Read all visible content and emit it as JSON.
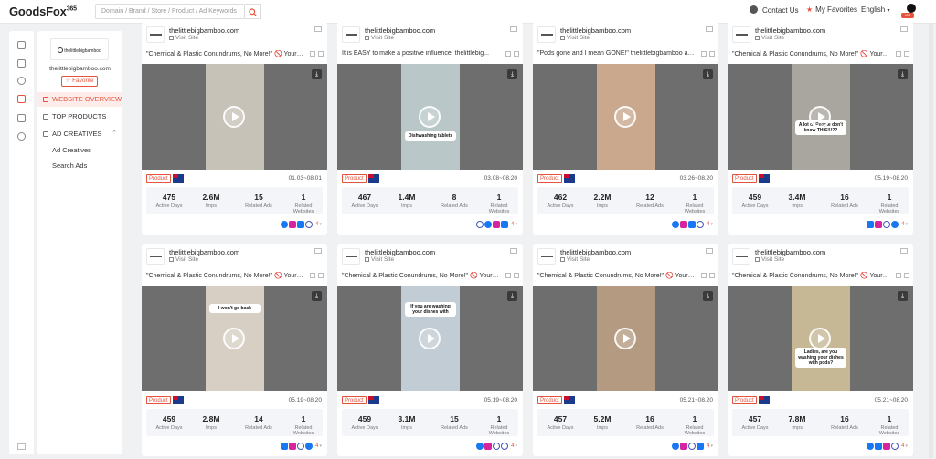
{
  "header": {
    "logo_text": "GoodsFox",
    "logo_suffix": "365",
    "search_placeholder": "Domain / Brand / Store / Product / Ad Keywords",
    "contact_label": "Contact Us",
    "favorites_label": "My Favorites",
    "language_label": "English",
    "vip_label": "VIP"
  },
  "sidebar": {
    "brand_logo_text": "thelittlebigbamboo",
    "brand_name": "thelittlebigbamboo.com",
    "favorite_label": "Favorite",
    "menu": {
      "website_overview": "WEBSITE OVERVIEW",
      "top_products": "TOP PRODUCTS",
      "ad_creatives": "AD CREATIVES",
      "sub_ad_creatives": "Ad Creatives",
      "sub_search_ads": "Search Ads"
    }
  },
  "stat_labels": {
    "active_days": "Active Days",
    "imps": "Imps",
    "related_ads": "Related Ads",
    "related_websites": "Related Websites"
  },
  "cards": [
    {
      "advertiser": "thelittlebigbamboo.com",
      "visit_label": "Visit Site",
      "title": "\"Chemical & Plastic Conundrums, No More!\" 🚫 Your ...",
      "badge": "Product",
      "date_range": "01.03~08.01",
      "active_days": "475",
      "imps": "2.6M",
      "related_ads": "15",
      "related_websites": "1",
      "more_count": "4",
      "thumb_color": "#c7c2b8",
      "platforms": [
        "messenger-icon",
        "instagram-icon",
        "facebook-icon",
        "audience-network-icon"
      ]
    },
    {
      "advertiser": "thelittlebigbamboo.com",
      "visit_label": "Visit Site",
      "title": "It is EASY to make a positive influence! thelittlebig...",
      "badge": "Product",
      "date_range": "03.08~08.20",
      "active_days": "467",
      "imps": "1.4M",
      "related_ads": "8",
      "related_websites": "1",
      "more_count": "4",
      "thumb_color": "#b9c7c9",
      "overlay": "Dishwashing tablets",
      "platforms": [
        "audience-network-icon",
        "messenger-icon",
        "instagram-icon",
        "facebook-icon"
      ]
    },
    {
      "advertiser": "thelittlebigbamboo.com",
      "visit_label": "Visit Site",
      "title": "\"Pods gone and I mean GONE!\" thelittlebigbamboo all...",
      "badge": "Product",
      "date_range": "03.26~08.20",
      "active_days": "462",
      "imps": "2.2M",
      "related_ads": "12",
      "related_websites": "1",
      "more_count": "4",
      "thumb_color": "#c9a88d",
      "platforms": [
        "messenger-icon",
        "instagram-icon",
        "facebook-icon",
        "audience-network-icon"
      ]
    },
    {
      "advertiser": "thelittlebigbamboo.com",
      "visit_label": "Visit Site",
      "title": "\"Chemical & Plastic Conundrums, No More!\" 🚫 Your ...",
      "badge": "Product",
      "date_range": "05.19~08.20",
      "active_days": "459",
      "imps": "3.4M",
      "related_ads": "16",
      "related_websites": "1",
      "more_count": "4",
      "thumb_color": "#a9a6a0",
      "overlay": "A lot of People don't know THIS!!!??",
      "platforms": [
        "facebook-icon",
        "instagram-icon",
        "audience-network-icon",
        "messenger-icon"
      ]
    },
    {
      "advertiser": "thelittlebigbamboo.com",
      "visit_label": "Visit Site",
      "title": "\"Chemical & Plastic Conundrums, No More!\" 🚫 Your ...",
      "badge": "Product",
      "date_range": "05.19~08.20",
      "active_days": "459",
      "imps": "2.8M",
      "related_ads": "14",
      "related_websites": "1",
      "more_count": "4",
      "thumb_color": "#d8cfc4",
      "overlay": "I won't go back",
      "platforms": [
        "facebook-icon",
        "instagram-icon",
        "audience-network-icon",
        "messenger-icon"
      ]
    },
    {
      "advertiser": "thelittlebigbamboo.com",
      "visit_label": "Visit Site",
      "title": "\"Chemical & Plastic Conundrums, No More!\" 🚫 Your ...",
      "badge": "Product",
      "date_range": "05.19~08.20",
      "active_days": "459",
      "imps": "3.1M",
      "related_ads": "15",
      "related_websites": "1",
      "more_count": "4",
      "thumb_color": "#c2ccd4",
      "overlay": "If you are washing your dishes with",
      "platforms": [
        "messenger-icon",
        "instagram-icon",
        "audience-network-icon",
        "audience-network-icon"
      ]
    },
    {
      "advertiser": "thelittlebigbamboo.com",
      "visit_label": "Visit Site",
      "title": "\"Chemical & Plastic Conundrums, No More!\" 🚫 Your ...",
      "badge": "Product",
      "date_range": "05.21~08.20",
      "active_days": "457",
      "imps": "5.2M",
      "related_ads": "16",
      "related_websites": "1",
      "more_count": "4",
      "thumb_color": "#b49a80",
      "platforms": [
        "messenger-icon",
        "instagram-icon",
        "audience-network-icon",
        "facebook-icon"
      ]
    },
    {
      "advertiser": "thelittlebigbamboo.com",
      "visit_label": "Visit Site",
      "title": "\"Chemical & Plastic Conundrums, No More!\" 🚫 Your ...",
      "badge": "Product",
      "date_range": "05.21~08.20",
      "active_days": "457",
      "imps": "7.8M",
      "related_ads": "16",
      "related_websites": "1",
      "more_count": "4",
      "thumb_color": "#c6b895",
      "overlay": "Ladies, are you washing your dishes with pods?",
      "platforms": [
        "messenger-icon",
        "facebook-icon",
        "instagram-icon",
        "audience-network-icon"
      ]
    }
  ]
}
